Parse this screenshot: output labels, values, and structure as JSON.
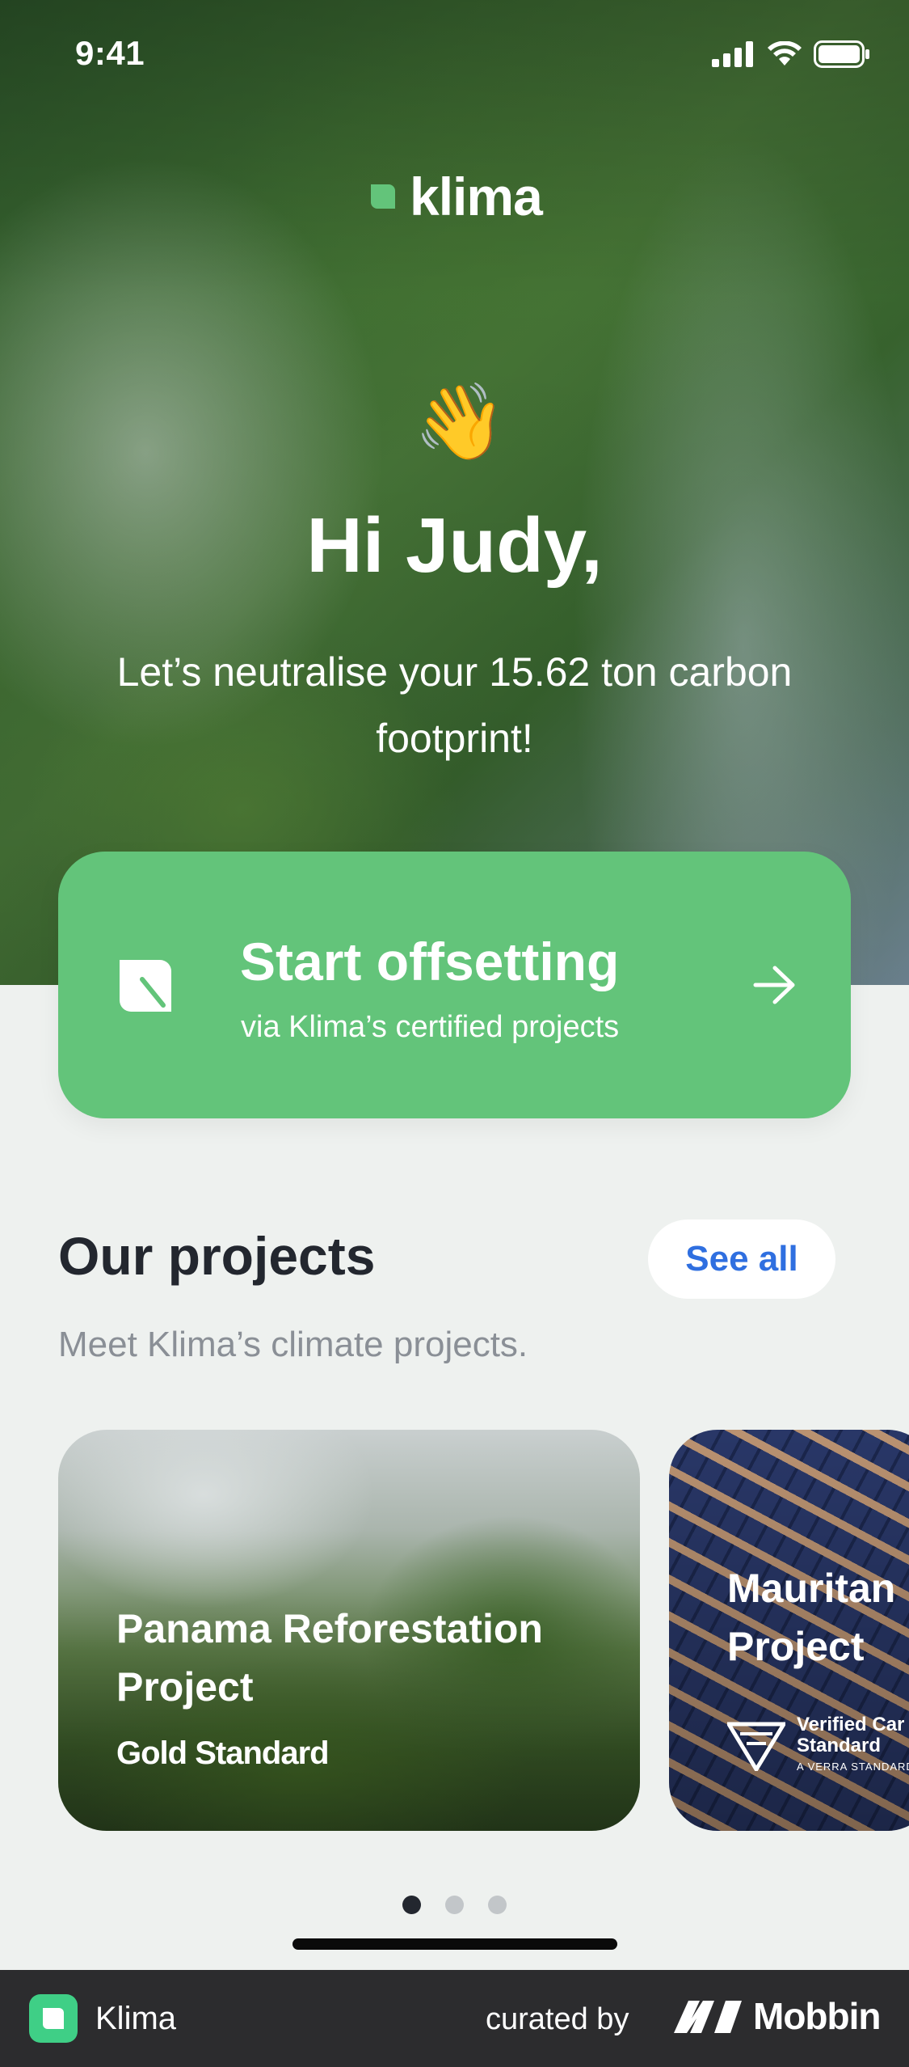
{
  "status_bar": {
    "time": "9:41",
    "icons": [
      "signal-icon",
      "wifi-icon",
      "battery-icon"
    ]
  },
  "header": {
    "logo_text": "klima",
    "logo_icon": "leaf-logo-icon"
  },
  "hero": {
    "emoji": "👋",
    "greeting": "Hi Judy,",
    "subtitle": "Let’s neutralise your 15.62 ton carbon footprint!"
  },
  "cta": {
    "title": "Start offsetting",
    "subtitle": "via Klima’s certified projects",
    "icon": "leaf-icon",
    "arrow_icon": "arrow-right-icon",
    "color": "#63c47a"
  },
  "projects": {
    "title": "Our projects",
    "see_all_label": "See all",
    "subtitle": "Meet Klima’s climate projects.",
    "cards": [
      {
        "title": "Panama Reforestation Project",
        "certification": "Gold Standard"
      },
      {
        "title_line1": "Mauritan",
        "title_line2": "Project",
        "badge_line1": "Verified Car",
        "badge_line2": "Standard",
        "badge_line3": "A VERRA STANDARD"
      }
    ],
    "pagination": {
      "count": 3,
      "active": 0
    }
  },
  "branding": {
    "app_name": "Klima",
    "curated_by": "curated by",
    "brand": "Mobbin"
  },
  "colors": {
    "accent_green": "#63c47a",
    "link_blue": "#2f6fe0",
    "background": "#eef1ef",
    "text_dark": "#23272f"
  }
}
